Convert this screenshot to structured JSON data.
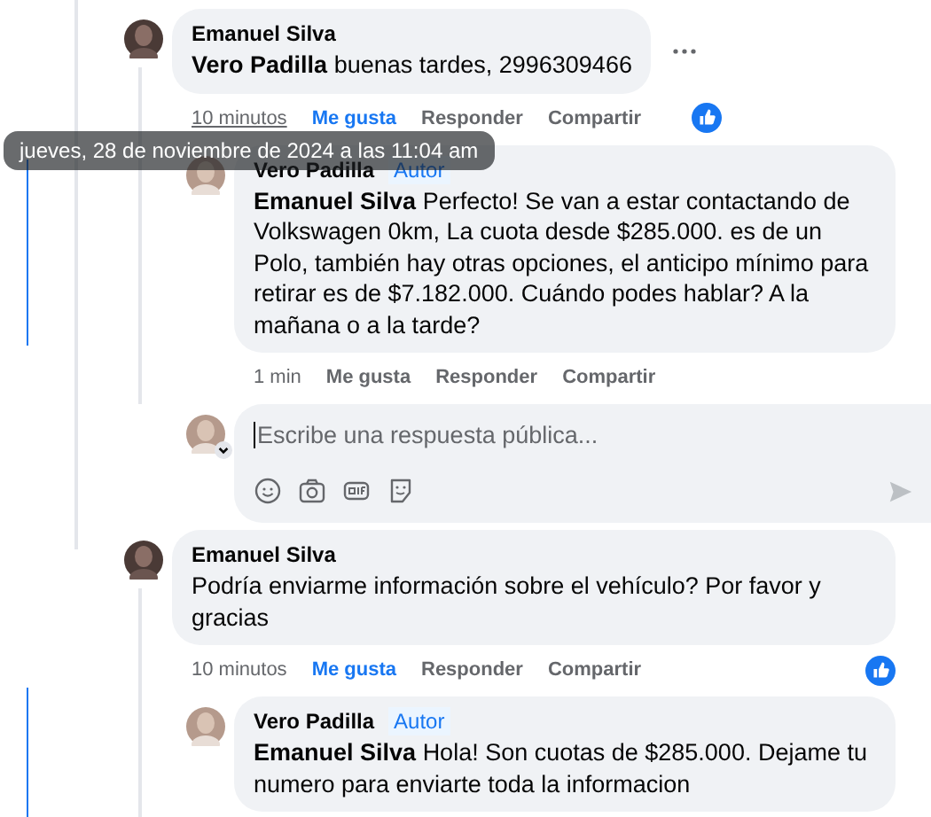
{
  "comments": [
    {
      "author": "Emanuel Silva",
      "mention": "Vero Padilla",
      "text": "buenas tardes, 2996309466",
      "actions": {
        "time": "10 minutos",
        "like": "Me gusta",
        "reply": "Responder",
        "share": "Compartir"
      },
      "time_hovered": true,
      "liked": true,
      "like_reaction": true,
      "menu_visible": true,
      "children": [
        {
          "author": "Vero Padilla",
          "badge": "Autor",
          "mention": "Emanuel Silva",
          "text": "Perfecto! Se van a estar contactando de Volkswagen 0km, La cuota desde $285.000. es de un Polo, también hay otras opciones, el anticipo mínimo para retirar es de $7.182.000. Cuándo podes hablar? A la mañana o a la tarde?",
          "actions": {
            "time": "1 min",
            "like": "Me gusta",
            "reply": "Responder",
            "share": "Compartir"
          },
          "time_hovered": false,
          "liked": false,
          "like_reaction": false
        }
      ],
      "reply_box": {
        "placeholder": "Escribe una respuesta pública..."
      }
    },
    {
      "author": "Emanuel Silva",
      "text": "Podría enviarme información sobre el vehículo? Por favor y gracias",
      "actions": {
        "time": "10 minutos",
        "like": "Me gusta",
        "reply": "Responder",
        "share": "Compartir"
      },
      "time_hovered": false,
      "liked": true,
      "like_reaction": true,
      "menu_visible": false,
      "children": [
        {
          "author": "Vero Padilla",
          "badge": "Autor",
          "mention": "Emanuel Silva",
          "text": "Hola! Son cuotas de $285.000. Dejame tu numero para enviarte toda la informacion"
        }
      ]
    }
  ],
  "tooltip": {
    "text": "jueves, 28 de noviembre de 2024 a las 11:04 am"
  }
}
